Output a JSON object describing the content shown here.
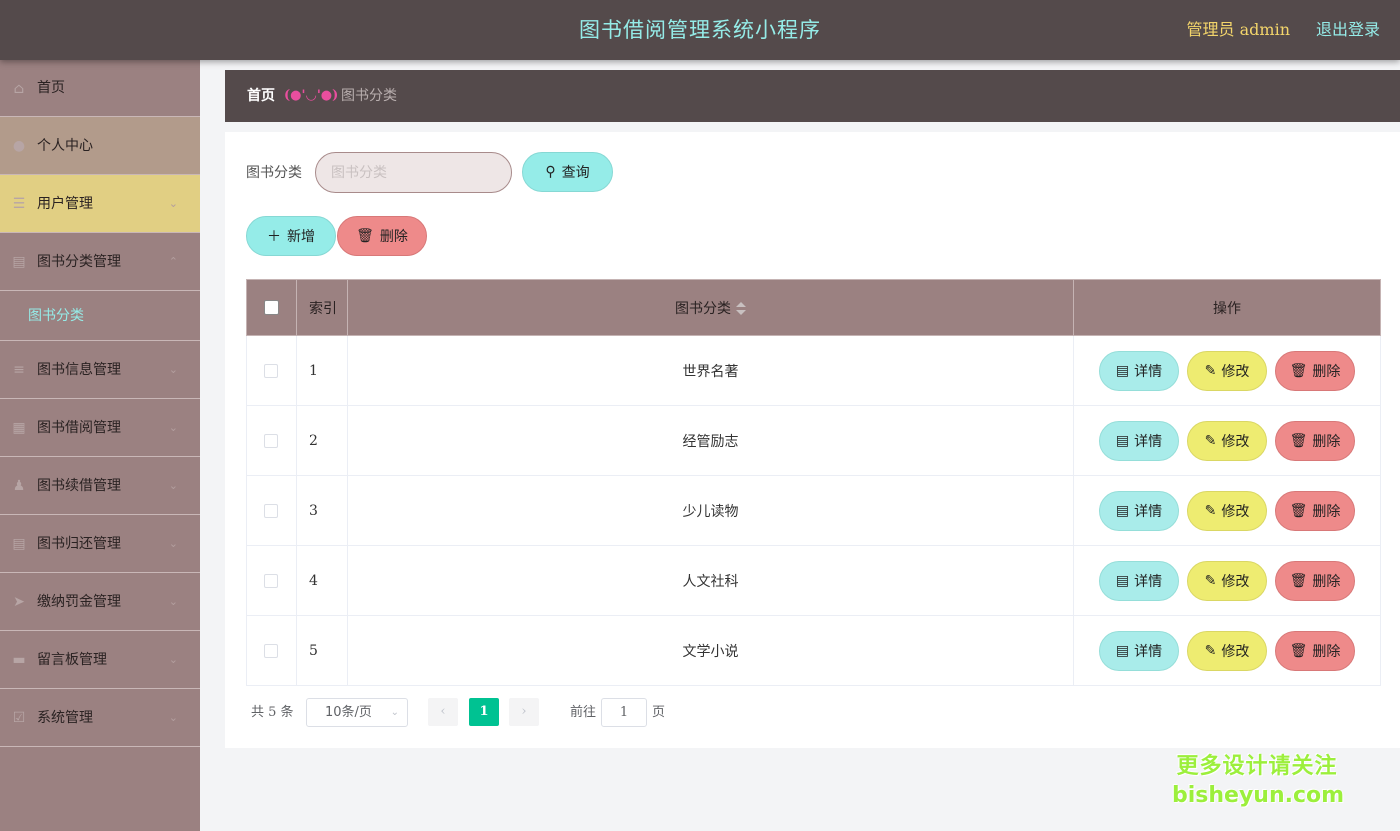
{
  "header": {
    "title": "图书借阅管理系统小程序",
    "user": "管理员 admin",
    "logout": "退出登录"
  },
  "sidebar": {
    "items": [
      {
        "label": "首页",
        "icon": "home-icon"
      },
      {
        "label": "个人中心",
        "icon": "user-icon"
      },
      {
        "label": "用户管理",
        "icon": "menu-icon",
        "chevron": "⌄"
      },
      {
        "label": "图书分类管理",
        "icon": "briefcase-icon",
        "chevron": "⌃"
      },
      {
        "label": "图书信息管理",
        "icon": "list-icon",
        "chevron": "⌄"
      },
      {
        "label": "图书借阅管理",
        "icon": "grid-icon",
        "chevron": "⌄"
      },
      {
        "label": "图书续借管理",
        "icon": "person-icon",
        "chevron": "⌄"
      },
      {
        "label": "图书归还管理",
        "icon": "briefcase-icon",
        "chevron": "⌄"
      },
      {
        "label": "缴纳罚金管理",
        "icon": "send-icon",
        "chevron": "⌄"
      },
      {
        "label": "留言板管理",
        "icon": "monitor-icon",
        "chevron": "⌄"
      },
      {
        "label": "系统管理",
        "icon": "check-icon",
        "chevron": "⌄"
      }
    ],
    "subitem": "图书分类"
  },
  "breadcrumb": {
    "home": "首页",
    "separator": "(●'◡'●)",
    "current": "图书分类"
  },
  "search": {
    "label": "图书分类",
    "placeholder": "图书分类",
    "query_label": "查询"
  },
  "actions": {
    "add_label": "新增",
    "delete_label": "删除"
  },
  "table": {
    "headers": {
      "index": "索引",
      "name": "图书分类",
      "ops": "操作"
    },
    "rows": [
      {
        "index": "1",
        "name": "世界名著"
      },
      {
        "index": "2",
        "name": "经管励志"
      },
      {
        "index": "3",
        "name": "少儿读物"
      },
      {
        "index": "4",
        "name": "人文社科"
      },
      {
        "index": "5",
        "name": "文学小说"
      }
    ],
    "op_labels": {
      "detail": "详情",
      "edit": "修改",
      "delete": "删除"
    }
  },
  "pagination": {
    "total": "共 5 条",
    "page_size": "10条/页",
    "current_page": "1",
    "goto_label": "前往",
    "goto_value": "1",
    "page_unit": "页"
  },
  "watermark": {
    "line1": "更多设计请关注",
    "line2": "bisheyun.com"
  },
  "colors": {
    "header_bg": "#544a4b",
    "sidebar_bg": "#9b8181",
    "accent_cyan": "#95ece8",
    "accent_yellow": "#eeec71",
    "accent_red": "#ee8a8a",
    "active_menu": "#e1cf83",
    "pager_active": "#00c292"
  }
}
